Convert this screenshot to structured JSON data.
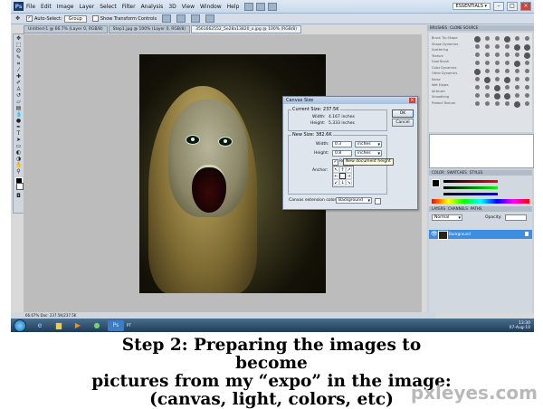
{
  "menubar": {
    "logo": "Ps",
    "items": [
      "File",
      "Edit",
      "Image",
      "Layer",
      "Select",
      "Filter",
      "Analysis",
      "3D",
      "View",
      "Window",
      "Help"
    ],
    "workspace": "ESSENTIALS ▾"
  },
  "options": {
    "auto_select": "Auto-Select:",
    "auto_select_value": "Group",
    "show_transform": "Show Transform Controls"
  },
  "tabs": [
    "Untitled-1 @ 66.7% (Layer 0, RGB/8)",
    "Step1.jpg @ 100% (Layer 0, RGB/8)",
    "3561662552_5e28a13820_o.jpg @ 100% (RGB/8)"
  ],
  "dialog": {
    "title": "Canvas Size",
    "current_label": "Current Size: 237.5K",
    "width_label": "Width:",
    "current_width": "4.167 inches",
    "height_label": "Height:",
    "current_height": "5.333 inches",
    "new_label": "New Size: 382.6K",
    "new_width_value": "0.3",
    "new_height_value": "0.8",
    "unit": "inches",
    "relative_label": "Relative",
    "anchor_label": "Anchor:",
    "ext_label": "Canvas extension color:",
    "ext_value": "Background",
    "ok": "OK",
    "cancel": "Cancel",
    "tooltip": "New document height"
  },
  "panels": {
    "brushes_tab": "BRUSHES",
    "clone_tab": "CLONE SOURCE",
    "color_tab": "COLOR",
    "swatches_tab": "SWATCHES",
    "styles_tab": "STYLES",
    "layers_tab": "LAYERS",
    "channels_tab": "CHANNELS",
    "paths_tab": "PATHS",
    "blend_mode": "Normal",
    "opacity_label": "Opacity:",
    "layer_name": "Background",
    "brush_presets": [
      "Brush Tip Shape",
      "Shape Dynamics",
      "Scattering",
      "Texture",
      "Dual Brush",
      "Color Dynamics",
      "Other Dynamics",
      "Noise",
      "Wet Edges",
      "Airbrush",
      "Smoothing",
      "Protect Texture"
    ]
  },
  "status": "66.67%   Doc: 237.5K/237.5K",
  "taskbar": {
    "time": "13:30",
    "date": "07-Aug-10",
    "tray": "PT"
  },
  "caption": {
    "line1": "Step 2: Preparing the images to become",
    "line2": "pictures from my “expo” in the image:",
    "line3": "(canvas, light, colors, etc)"
  },
  "watermark": "pxleyes.com"
}
